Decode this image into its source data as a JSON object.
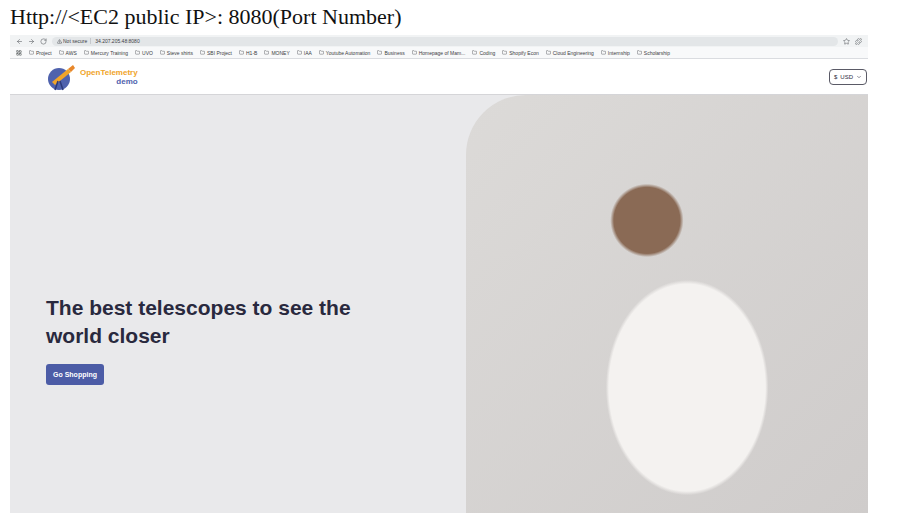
{
  "caption": "Http://<EC2 public IP>: 8080(Port Number)",
  "browser": {
    "security": "Not secure",
    "url": "34.207.205.48:8080",
    "bookmarks": [
      "Project",
      "AWS",
      "Mercury Training",
      "UVO",
      "Steve shirts",
      "SBI Project",
      "H1-B",
      "MONEY",
      "IAA",
      "Youtube Automation",
      "Business",
      "Homepage of Mam...",
      "Coding",
      "Shopify Econ",
      "Cloud Engineering",
      "Internship",
      "Scholarship"
    ]
  },
  "header": {
    "logo": {
      "name": "OpenTelemetry",
      "sub": "demo"
    },
    "currency": {
      "symbol": "$",
      "code": "USD"
    }
  },
  "hero": {
    "title": "The best telescopes to see the world closer",
    "button": "Go Shopping"
  }
}
